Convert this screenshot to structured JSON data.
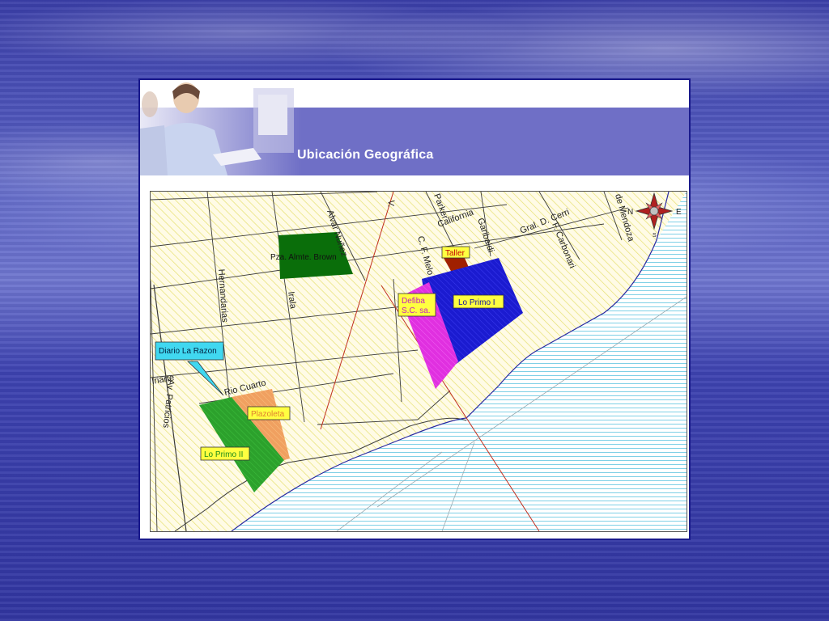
{
  "header": {
    "title": "Ubicación Geográfica"
  },
  "colors": {
    "water": "#7fd0e6",
    "land_hatch": "#e6e070",
    "lo_primo_i": "#1b1bd0",
    "lo_primo_ii": "#2ca12c",
    "defiba": "#e030e0",
    "plazoleta": "#f0a060",
    "plaza": "#0a6e0a",
    "taller": "#a02000",
    "diario": "#40d8f0"
  },
  "map": {
    "streets": {
      "alvar_nunez": "Alvar Nuñez",
      "hernandarias": "Hernandarias",
      "irala": "Irala",
      "rio_cuarto": "Rio Cuarto",
      "iriarte": "Iriarte",
      "patricios": "Av. Patricios",
      "parker": "Parker",
      "california": "California",
      "garibaldi": "Garibaldi",
      "melo": "C. F. Melo",
      "gral_cerri": "Gral. D. Cerri",
      "carbonari": "F. Carbonari",
      "mendoza": "de Mendoza",
      "top_left_fragment": "V."
    },
    "places": {
      "plaza": "Pza. Almte. Brown",
      "taller": "Taller",
      "defiba_1": "Defiba",
      "defiba_2": "S.C. sa.",
      "lo_primo_i": "Lo Primo I",
      "lo_primo_ii": "Lo Primo II",
      "plazoleta": "Plazoleta",
      "diario": "Diario La Razon"
    },
    "compass": {
      "n": "N",
      "e": "E",
      "s": "S"
    }
  }
}
